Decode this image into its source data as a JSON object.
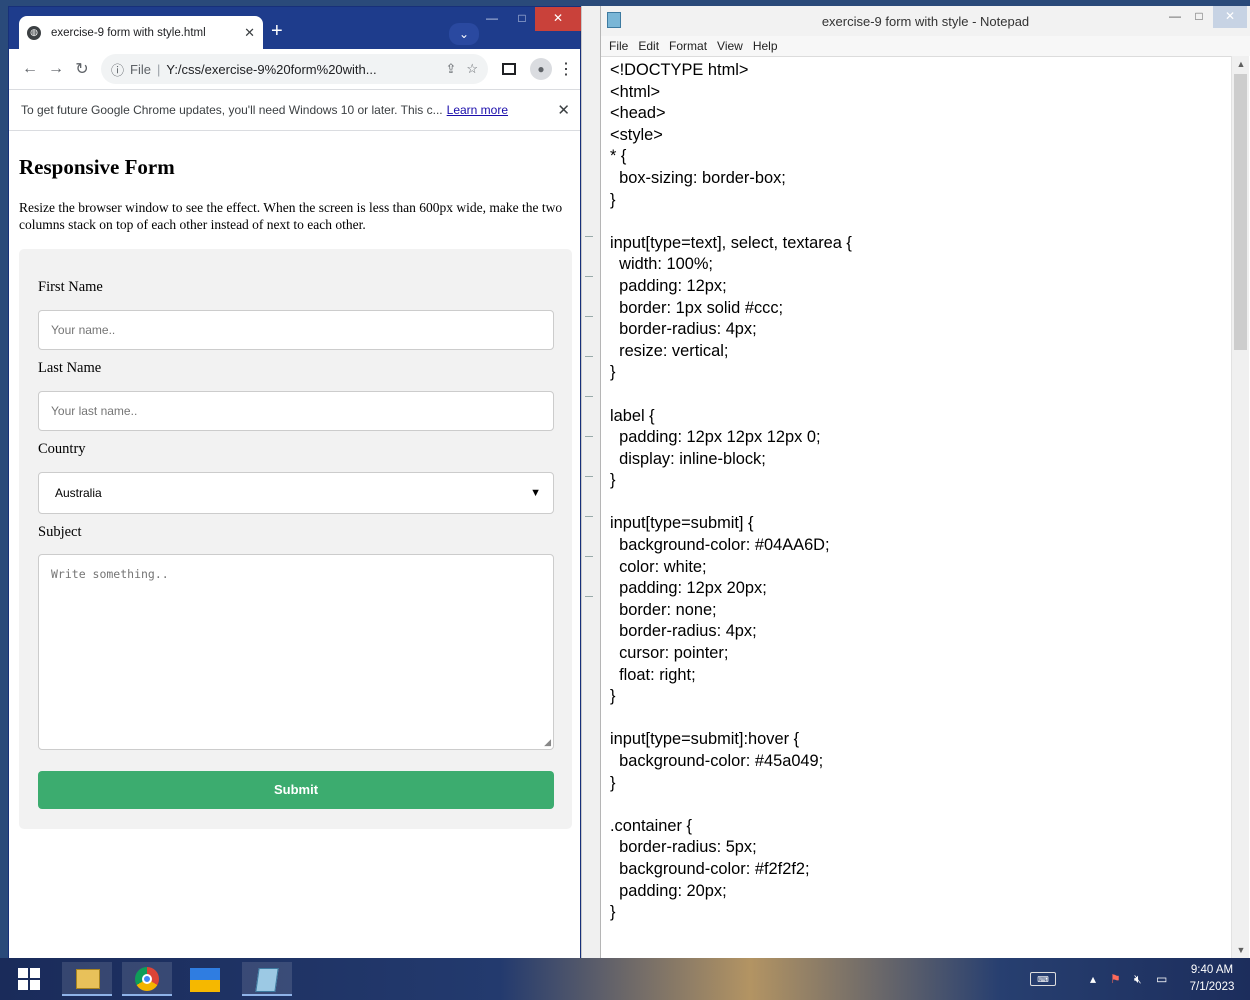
{
  "chrome": {
    "tab_title": "exercise-9 form with style.html",
    "address_label": "File",
    "address_url": "Y:/css/exercise-9%20form%20with...",
    "infobar_message": "To get future Google Chrome updates, you'll need Windows 10 or later. This c...",
    "infobar_link": "Learn more",
    "page": {
      "heading": "Responsive Form",
      "intro": "Resize the browser window to see the effect. When the screen is less than 600px wide, make the two columns stack on top of each other instead of next to each other.",
      "first_name_label": "First Name",
      "first_name_placeholder": "Your name..",
      "last_name_label": "Last Name",
      "last_name_placeholder": "Your last name..",
      "country_label": "Country",
      "country_value": "Australia",
      "subject_label": "Subject",
      "subject_placeholder": "Write something..",
      "submit_label": "Submit"
    }
  },
  "notepad": {
    "title": "exercise-9 form with style - Notepad",
    "menu": [
      "File",
      "Edit",
      "Format",
      "View",
      "Help"
    ],
    "code": "<!DOCTYPE html>\n<html>\n<head>\n<style>\n* {\n  box-sizing: border-box;\n}\n\ninput[type=text], select, textarea {\n  width: 100%;\n  padding: 12px;\n  border: 1px solid #ccc;\n  border-radius: 4px;\n  resize: vertical;\n}\n\nlabel {\n  padding: 12px 12px 12px 0;\n  display: inline-block;\n}\n\ninput[type=submit] {\n  background-color: #04AA6D;\n  color: white;\n  padding: 12px 20px;\n  border: none;\n  border-radius: 4px;\n  cursor: pointer;\n  float: right;\n}\n\ninput[type=submit]:hover {\n  background-color: #45a049;\n}\n\n.container {\n  border-radius: 5px;\n  background-color: #f2f2f2;\n  padding: 20px;\n}"
  },
  "taskbar": {
    "time": "9:40 AM",
    "date": "7/1/2023"
  }
}
